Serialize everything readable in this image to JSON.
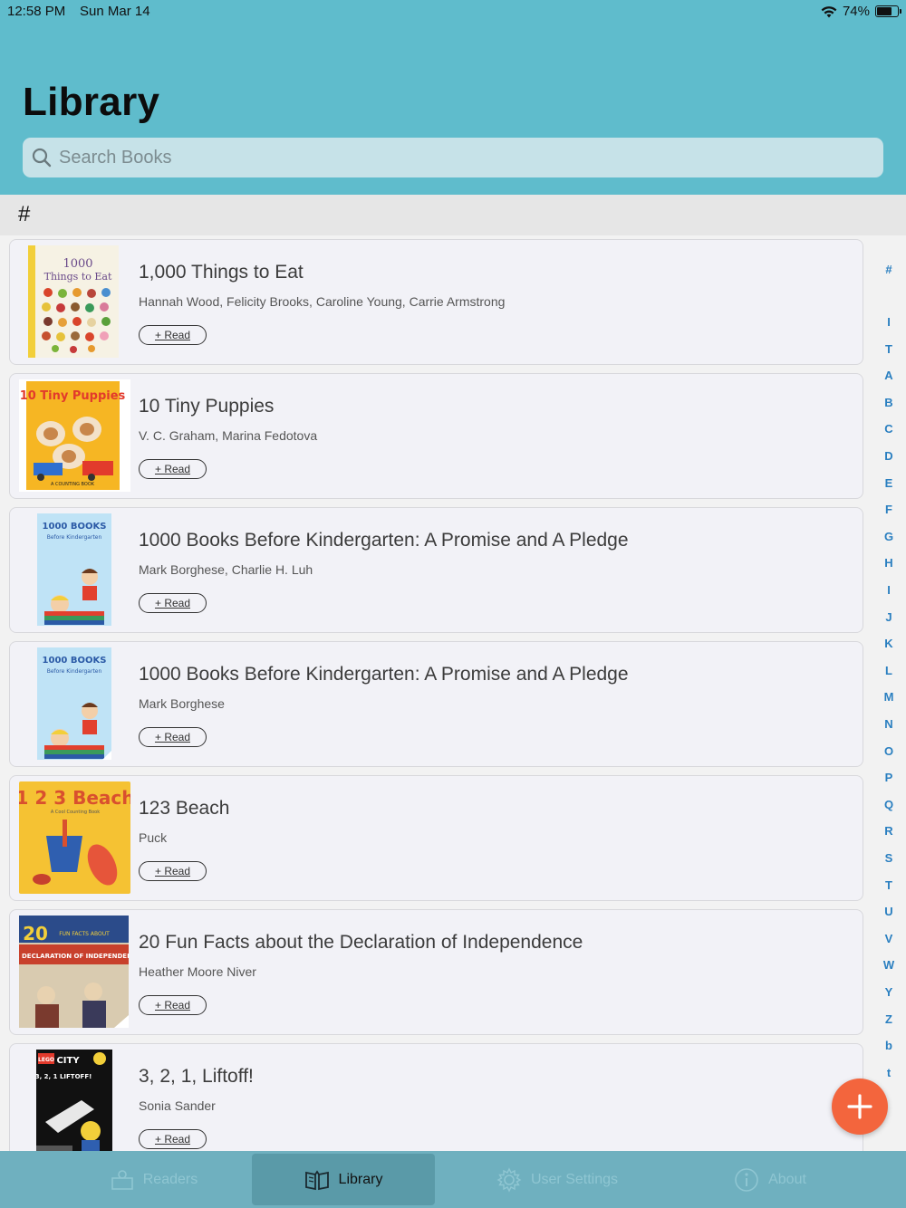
{
  "status_bar": {
    "time": "12:58 PM",
    "date": "Sun Mar 14",
    "battery_percent": "74%",
    "battery_level": 0.74
  },
  "page_title": "Library",
  "search": {
    "placeholder": "Search Books",
    "value": ""
  },
  "section_header": "#",
  "books": [
    {
      "title": "1,000 Things to Eat",
      "authors": "Hannah Wood, Felicity Brooks, Caroline Young, Carrie Armstrong",
      "read_label": "+ Read",
      "cover_text": [
        "1000",
        "Things to Eat"
      ],
      "cover_colors": [
        "#f6f2e4",
        "#f2cf3a"
      ]
    },
    {
      "title": "10 Tiny Puppies",
      "authors": "V. C. Graham, Marina Fedotova",
      "read_label": "+ Read",
      "cover_text": [
        "10 Tiny Puppies",
        "A COUNTING BOOK"
      ],
      "cover_colors": [
        "#f6b623",
        "#e23a2c"
      ]
    },
    {
      "title": "1000 Books Before Kindergarten: A Promise and A Pledge",
      "authors": "Mark Borghese, Charlie H. Luh",
      "read_label": "+ Read",
      "cover_text": [
        "1000 BOOKS",
        "Before Kindergarten"
      ],
      "cover_colors": [
        "#bfe3f6",
        "#2b5aa6"
      ]
    },
    {
      "title": "1000 Books Before Kindergarten: A Promise and A Pledge",
      "authors": "Mark Borghese",
      "read_label": "+ Read",
      "cover_text": [
        "1000 BOOKS",
        "Before Kindergarten"
      ],
      "cover_colors": [
        "#bfe3f6",
        "#2b5aa6"
      ]
    },
    {
      "title": "123 Beach",
      "authors": "Puck",
      "read_label": "+ Read",
      "cover_text": [
        "1 2 3 Beach",
        "A Cool Counting Book"
      ],
      "cover_colors": [
        "#f5c233",
        "#d9502e"
      ]
    },
    {
      "title": "20 Fun Facts about the Declaration of Independence",
      "authors": "Heather Moore Niver",
      "read_label": "+ Read",
      "cover_text": [
        "20",
        "FUN FACTS ABOUT",
        "THE DECLARATION OF INDEPENDENCE"
      ],
      "cover_colors": [
        "#2b4b8a",
        "#c8402c"
      ]
    },
    {
      "title": "3, 2, 1, Liftoff!",
      "authors": "Sonia Sander",
      "read_label": "+ Read",
      "cover_text": [
        "LEGO",
        "CITY",
        "3, 2, 1 LIFTOFF!"
      ],
      "cover_colors": [
        "#111111",
        "#e23a2c"
      ]
    }
  ],
  "index_letters": [
    "#",
    "I",
    "T",
    "A",
    "B",
    "C",
    "D",
    "E",
    "F",
    "G",
    "H",
    "I",
    "J",
    "K",
    "L",
    "M",
    "N",
    "O",
    "P",
    "Q",
    "R",
    "S",
    "T",
    "U",
    "V",
    "W",
    "Y",
    "Z",
    "b",
    "t"
  ],
  "tabs": [
    {
      "label": "Readers",
      "icon": "readers-icon",
      "active": false
    },
    {
      "label": "Library",
      "icon": "library-book-icon",
      "active": true
    },
    {
      "label": "User Settings",
      "icon": "gear-icon",
      "active": false
    },
    {
      "label": "About",
      "icon": "info-icon",
      "active": false
    }
  ],
  "colors": {
    "header": "#5fbccc",
    "tab_bar": "#6fb0bf",
    "fab": "#f3653d",
    "index_letters": "#2a7fc0"
  }
}
